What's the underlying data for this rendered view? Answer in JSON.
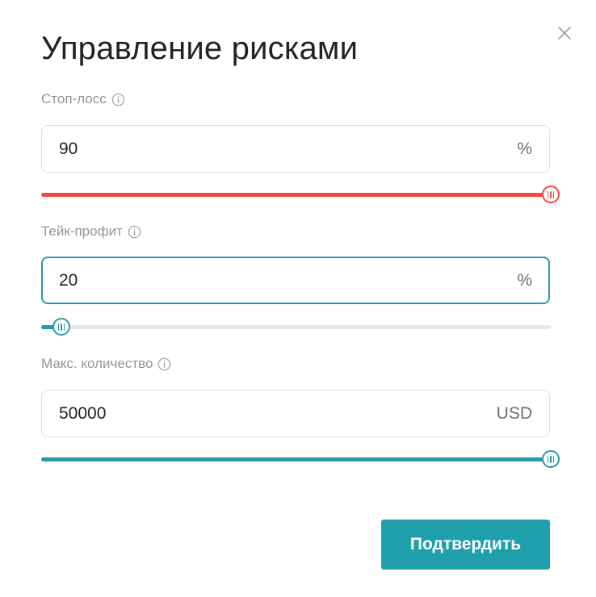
{
  "dialog": {
    "title": "Управление рисками",
    "close_icon": "close-icon",
    "confirm_label": "Подтвердить"
  },
  "colors": {
    "danger": "#ef4b40",
    "accent": "#2a9aa8",
    "button": "#1f9eac",
    "track": "#e5e7ea"
  },
  "stop_loss": {
    "label": "Стоп-лосс",
    "value": "90",
    "unit": "%",
    "slider_level": 1.0
  },
  "take_profit": {
    "label": "Тейк-профит",
    "value": "20",
    "unit": "%",
    "slider_level": 0.04
  },
  "max_quantity": {
    "label": "Макс. количество",
    "value": "50000",
    "unit": "USD",
    "slider_level": 1.0
  }
}
